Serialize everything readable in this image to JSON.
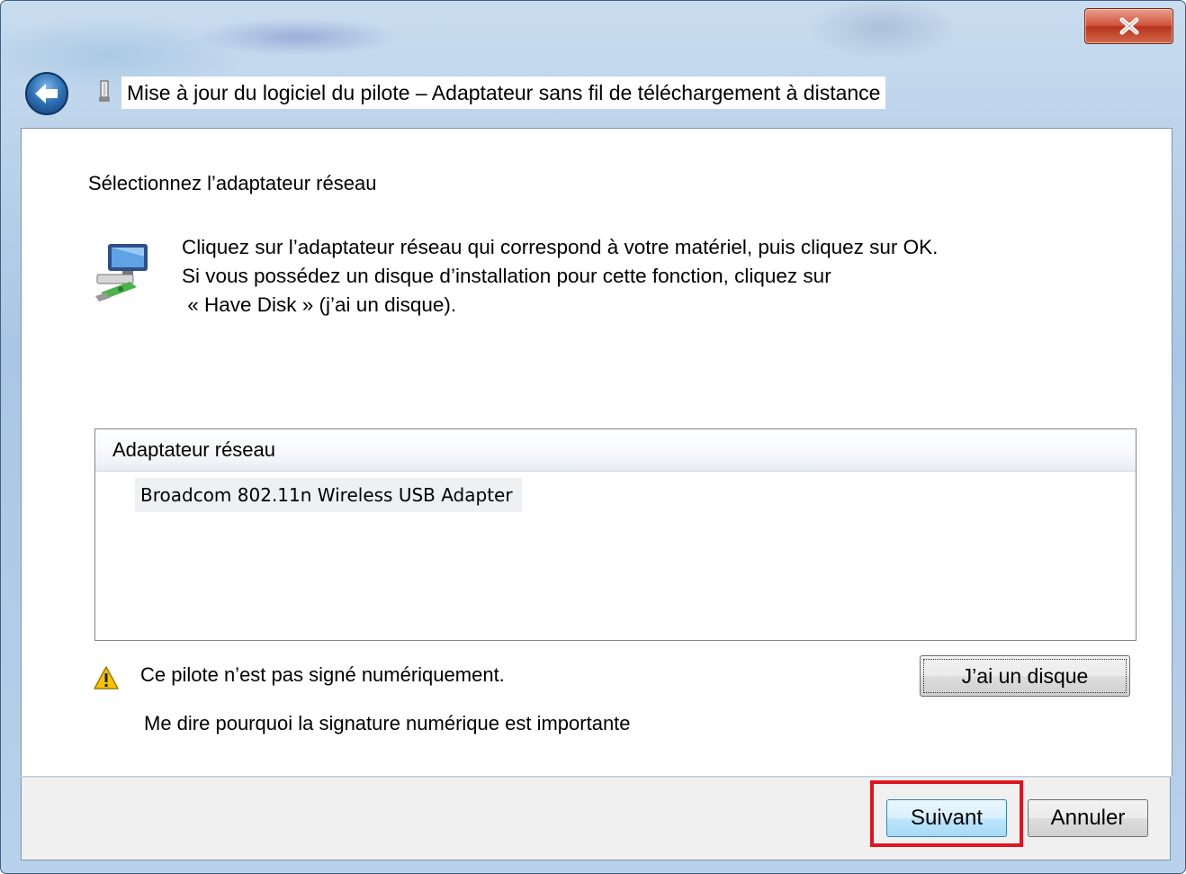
{
  "window": {
    "title": "Mise à jour du logiciel du pilote – Adaptateur sans fil de téléchargement à distance",
    "close_glyph": "X"
  },
  "main": {
    "heading": "Sélectionnez l’adaptateur réseau",
    "instructions": [
      "Cliquez sur l’adaptateur réseau qui correspond à votre matériel, puis cliquez sur OK.",
      "Si vous possédez un disque d’installation pour cette fonction, cliquez sur",
      " « Have Disk » (j’ai un disque)."
    ],
    "list": {
      "header": "Adaptateur réseau",
      "items": [
        "Broadcom 802.11n Wireless USB Adapter"
      ]
    },
    "warning": "Ce pilote n’est pas signé numériquement.",
    "why_link": "Me dire pourquoi la signature numérique est importante",
    "have_disk_label": "J’ai un disque"
  },
  "footer": {
    "next_label": "Suivant",
    "cancel_label": "Annuler"
  },
  "icons": {
    "back": "back-arrow-icon",
    "title": "driver-icon",
    "network": "network-adapter-icon",
    "warning": "warning-icon",
    "close": "close-icon"
  },
  "colors": {
    "highlight": "#e0141e",
    "frame": "#a9c6e4",
    "close_button": "#c8452c"
  }
}
